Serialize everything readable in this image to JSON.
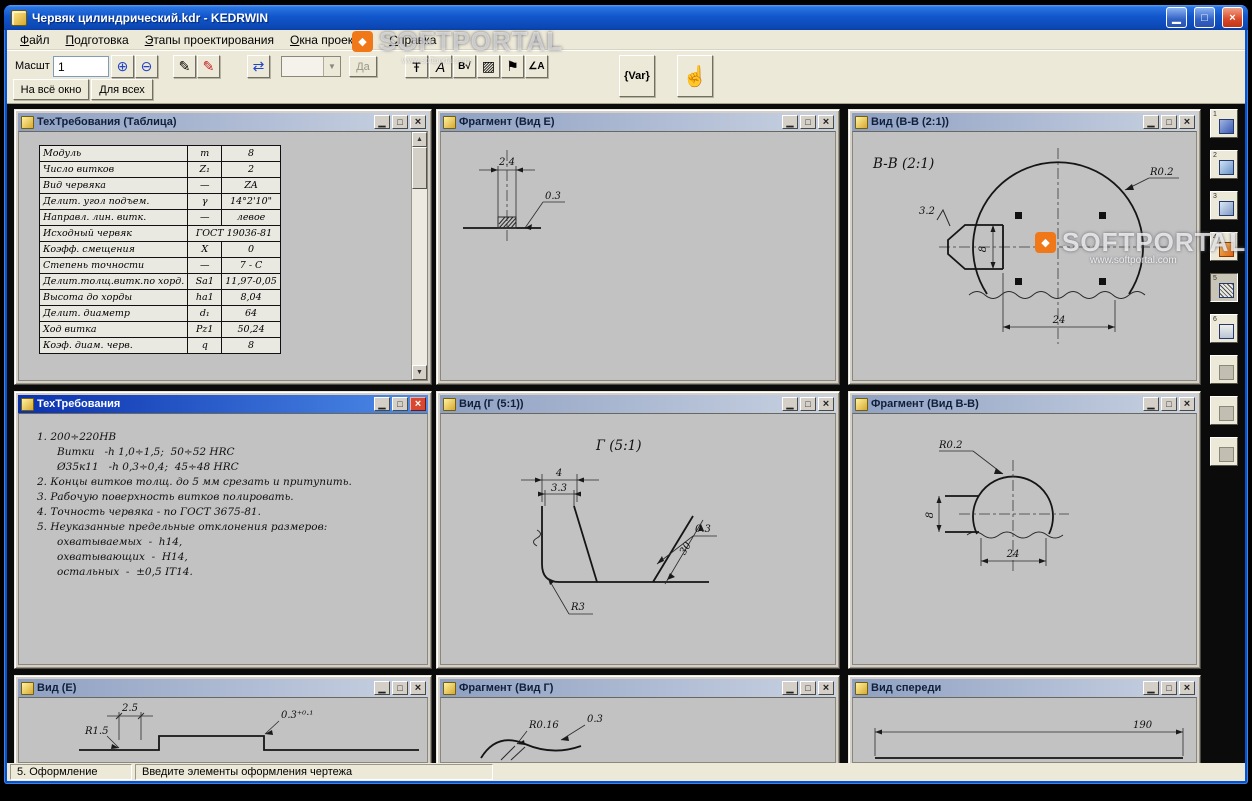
{
  "window": {
    "title": "Червяк цилиндрический.kdr - KEDRWIN"
  },
  "icons": {
    "min": "▁",
    "max": "□",
    "close": "×",
    "zoom_in": "⊕",
    "zoom_out": "⊖",
    "pen": "✎",
    "red_pen": "✎",
    "swap": "⇄",
    "dim_tool": "Ŧ",
    "text_tool": "A",
    "tol_tool": "B√",
    "hatch_tool": "▨",
    "flag_tool": "⚑",
    "angle_tool": "∠A",
    "thumb": "☝",
    "combo_arrow": "▼",
    "scroll_up": "▲",
    "scroll_down": "▼",
    "logo": "◆"
  },
  "menu": {
    "items": [
      "Файл",
      "Подготовка",
      "Этапы проектирования",
      "Окна проекций",
      "Справка"
    ]
  },
  "toolbar": {
    "scale_label": "Масшт",
    "scale_value": "1",
    "fit_all": "На всё окно",
    "for_all": "Для всех",
    "yes_label": "Да",
    "var_label": "{Var}"
  },
  "windows": {
    "tech_table": {
      "title": "ТехТребования (Таблица)"
    },
    "frag_e": {
      "title": "Фрагмент (Вид Е)"
    },
    "view_bb": {
      "title": "Вид (В-В (2:1))"
    },
    "techreq": {
      "title": "ТехТребования"
    },
    "view_g": {
      "title": "Вид (Г (5:1))"
    },
    "frag_bb": {
      "title": "Фрагмент (Вид В-В)"
    },
    "view_e": {
      "title": "Вид (Е)"
    },
    "frag_g": {
      "title": "Фрагмент (Вид Г)"
    },
    "view_front": {
      "title": "Вид спереди"
    }
  },
  "table": {
    "rows": [
      [
        "Модуль",
        "m",
        "8"
      ],
      [
        "Число витков",
        "Z₁",
        "2"
      ],
      [
        "Вид червяка",
        "—",
        "ZA"
      ],
      [
        "Делит. угол подъем.",
        "γ",
        "14°2'10\""
      ],
      [
        "Направл. лин. витк.",
        "—",
        "левое"
      ],
      [
        "Исходный червяк",
        "ГОСТ 19036-81",
        ""
      ],
      [
        "Коэфф. смещения",
        "X",
        "0"
      ],
      [
        "Степень точности",
        "—",
        "7 - C"
      ],
      [
        "Делит.толщ.витк.по хорд.",
        "Sa1",
        "11,97-0,05"
      ],
      [
        "Высота до хорды",
        "ha1",
        "8,04"
      ],
      [
        "Делит. диаметр",
        "d₁",
        "64"
      ],
      [
        "Ход витка",
        "Pz1",
        "50,24"
      ],
      [
        "Коэф. диам. черв.",
        "q",
        "8"
      ]
    ]
  },
  "techreq": {
    "lines": [
      "1. 200÷220HB",
      "      Витки   -h 1,0÷1,5;  50÷52 HRC",
      "      Ø35к11   -h 0,3÷0,4;  45÷48 HRC",
      "2. Концы витков толщ. до 5 мм срезать и притупить.",
      "3. Рабочую поверхность витков полировать.",
      "4. Точность червяка - по ГОСТ 3675-81.",
      "5. Неуказанные предельные отклонения размеров:",
      "      охватываемых  -  h14,",
      "      охватывающих  -  H14,",
      "      остальных  -  ±0,5 IT14."
    ]
  },
  "drawings": {
    "frag_e": {
      "dim1": "2.4",
      "lead": "0.3"
    },
    "view_bb": {
      "label": "B-B  (2:1)",
      "radius": "R0.2",
      "rough": "3.2",
      "height": "8",
      "width": "24"
    },
    "view_g": {
      "label": "Г  (5:1)",
      "dim1": "4",
      "dim2": "3.3",
      "lead": "0.3",
      "fillet": "R3",
      "flank": "30"
    },
    "frag_bb": {
      "radius": "R0.2",
      "height": "8",
      "width": "24"
    },
    "view_e": {
      "radius": "R1.5",
      "dim1": "2.5",
      "tol": "0.3⁺⁰·¹"
    },
    "frag_g": {
      "radius": "R0.16",
      "lead": "0.3"
    },
    "view_front": {
      "width": "190"
    }
  },
  "sidebar": {
    "items": [
      {
        "num": "1"
      },
      {
        "num": "2"
      },
      {
        "num": "3"
      },
      {
        "num": "4"
      },
      {
        "num": "5"
      },
      {
        "num": "6"
      },
      {
        "num": ""
      },
      {
        "num": ""
      },
      {
        "num": ""
      }
    ]
  },
  "statusbar": {
    "stage": "5. Оформление",
    "message": "Введите элементы оформления чертежа"
  },
  "watermark": {
    "brand": "SOFTPORTAL",
    "site": "www.softportal.com"
  }
}
